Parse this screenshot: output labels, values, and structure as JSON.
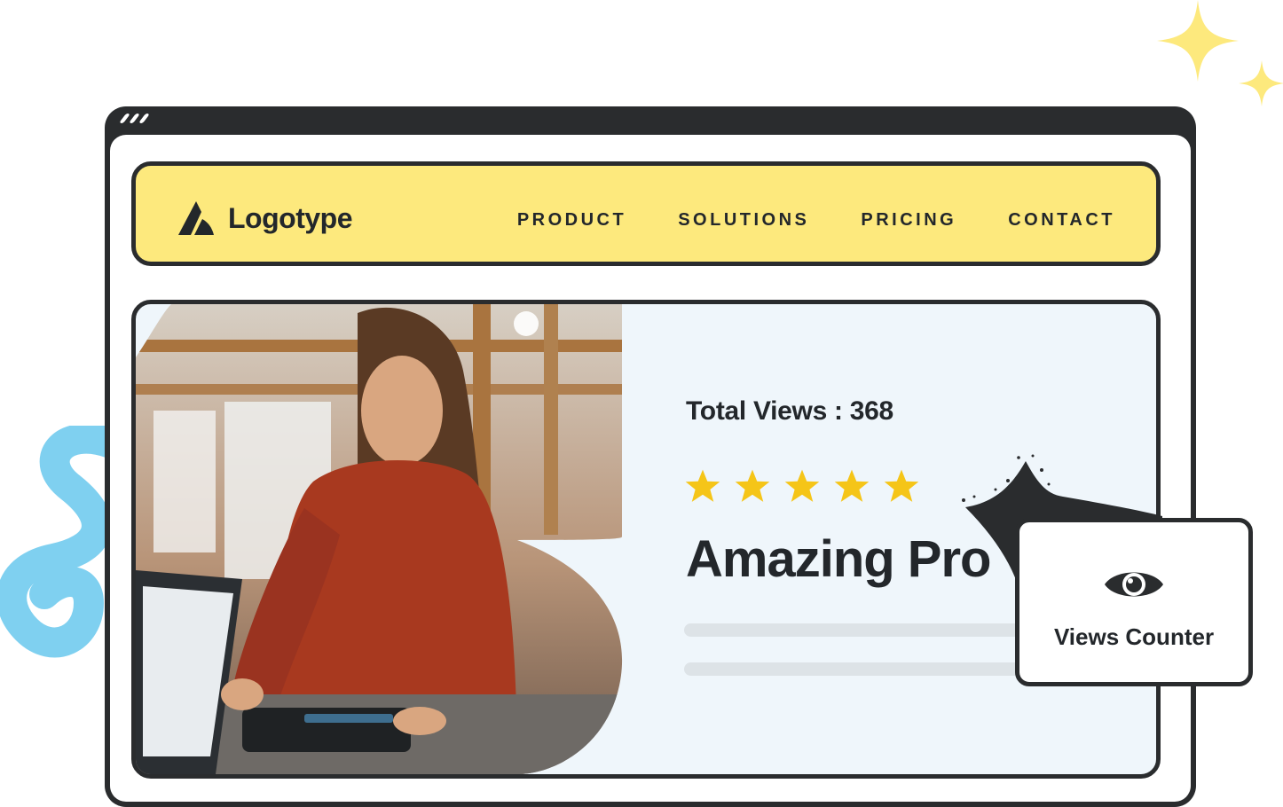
{
  "logo": {
    "text": "Logotype"
  },
  "nav": {
    "items": [
      {
        "label": "PRODUCT"
      },
      {
        "label": "SOLUTIONS"
      },
      {
        "label": "PRICING"
      },
      {
        "label": "CONTACT"
      }
    ]
  },
  "hero": {
    "views_text": "Total Views : 368",
    "rating": {
      "stars": 5,
      "max": 5
    },
    "title": "Amazing Pro"
  },
  "counter_card": {
    "icon": "eye-icon",
    "label": "Views Counter"
  },
  "colors": {
    "nav_bg": "#fde97d",
    "hero_bg": "#eff6fb",
    "frame": "#2a2c2e",
    "star": "#f5c518",
    "accent_blue": "#7fd0f0"
  }
}
